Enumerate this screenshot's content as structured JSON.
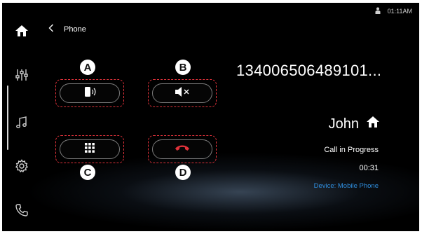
{
  "status_bar": {
    "time": "01:11AM",
    "icon": "person-icon"
  },
  "header": {
    "back_icon": "chevron-left-icon",
    "title": "Phone"
  },
  "sidebar": [
    {
      "name": "home",
      "icon": "home-icon"
    },
    {
      "name": "settings-sliders",
      "icon": "sliders-icon"
    },
    {
      "name": "music",
      "icon": "music-note-icon"
    },
    {
      "name": "settings",
      "icon": "gear-icon"
    },
    {
      "name": "phone",
      "icon": "phone-icon"
    }
  ],
  "controls": [
    {
      "label": "A",
      "function": "audio-transfer",
      "icon": "phone-sound-icon"
    },
    {
      "label": "B",
      "function": "mute",
      "icon": "mute-speaker-icon"
    },
    {
      "label": "C",
      "function": "keypad",
      "icon": "keypad-icon"
    },
    {
      "label": "D",
      "function": "end-call",
      "icon": "hang-up-icon"
    }
  ],
  "call": {
    "number": "134006506489101...",
    "contact": "John",
    "contact_icon": "home-icon",
    "status": "Call in Progress",
    "duration": "00:31",
    "device": "Device: Mobile Phone"
  },
  "colors": {
    "accent_blue": "#2f8fe0",
    "end_call_red": "#e0323a",
    "annotation_red": "#e0323a"
  }
}
